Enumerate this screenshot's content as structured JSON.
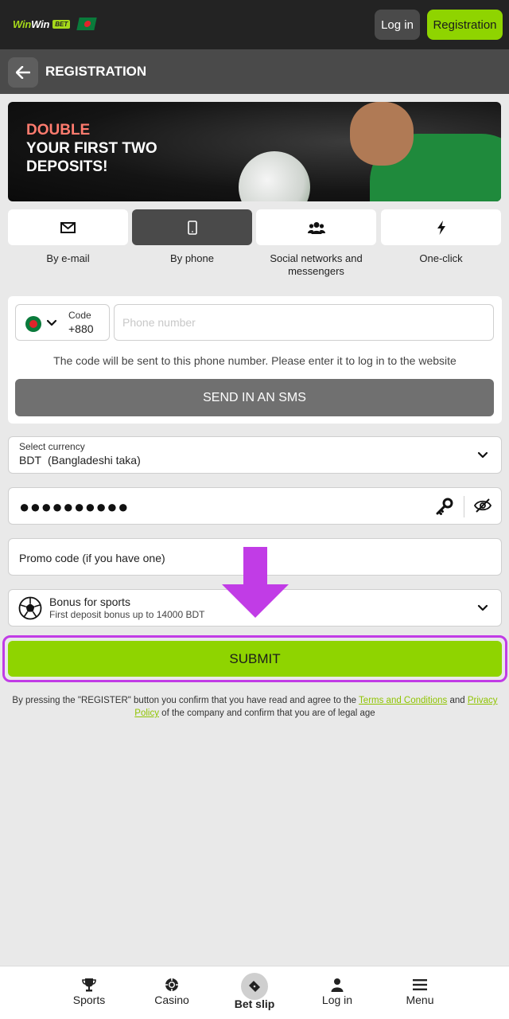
{
  "header": {
    "logo": {
      "word1": "Win",
      "word2": "Win",
      "badge": "BET"
    },
    "login_label": "Log in",
    "register_label": "Registration"
  },
  "subheader": {
    "title": "REGISTRATION"
  },
  "banner": {
    "highlight": "DOUBLE",
    "line2": "YOUR FIRST TWO",
    "line3": "DEPOSITS!"
  },
  "methods": [
    {
      "label": "By e-mail",
      "icon": "envelope-icon",
      "active": false
    },
    {
      "label": "By phone",
      "icon": "phone-icon",
      "active": true
    },
    {
      "label": "Social networks and messengers",
      "icon": "users-icon",
      "active": false
    },
    {
      "label": "One-click",
      "icon": "lightning-icon",
      "active": false
    }
  ],
  "phone": {
    "code_label": "Code",
    "code_value": "+880",
    "number_placeholder": "Phone number",
    "hint": "The code will be sent to this phone number. Please enter it to log in to the website",
    "sms_button": "SEND IN AN SMS"
  },
  "currency": {
    "label": "Select currency",
    "code": "BDT",
    "name": "(Bangladeshi taka)"
  },
  "password": {
    "masked": "●●●●●●●●●●"
  },
  "promo": {
    "placeholder": "Promo code (if you have one)"
  },
  "bonus": {
    "title": "Bonus for sports",
    "subtitle": "First deposit bonus up to 14000 BDT"
  },
  "submit_label": "SUBMIT",
  "legal": {
    "before": "By pressing the \"REGISTER\" button you confirm that you have read and agree to the ",
    "terms": "Terms and Conditions",
    "and": " and ",
    "privacy": "Privacy Policy",
    "after": " of the company and confirm that you are of legal age"
  },
  "colors": {
    "accent": "#8fd400",
    "highlight_border": "#c13ce6",
    "header_bg": "#232323"
  },
  "nav": [
    {
      "label": "Sports",
      "icon": "trophy-icon"
    },
    {
      "label": "Casino",
      "icon": "chip-icon"
    },
    {
      "label": "Bet slip",
      "icon": "ticket-icon"
    },
    {
      "label": "Log in",
      "icon": "user-icon"
    },
    {
      "label": "Menu",
      "icon": "menu-icon"
    }
  ]
}
